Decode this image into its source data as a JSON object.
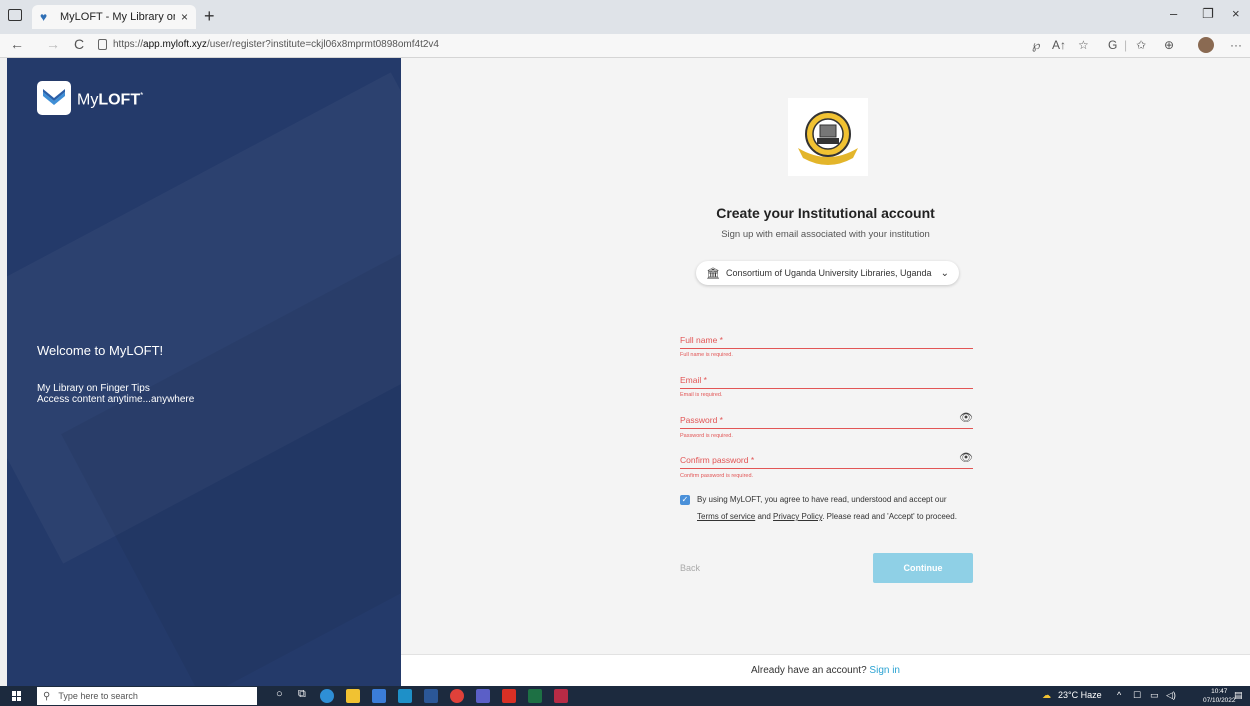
{
  "browser": {
    "tab_title": "MyLOFT - My Library on Finger T",
    "tab_close": "×",
    "new_tab": "+",
    "url_prefix": "https://",
    "url_host": "app.myloft.xyz",
    "url_path": "/user/register?institute=ckjl06x8mprmt0898omf4t2v4",
    "window_controls": [
      "–",
      "❐",
      "×"
    ],
    "nav_icons": [
      "←",
      "→",
      "C"
    ],
    "toolbar_icons": [
      "℘",
      "A↑",
      "☆",
      "G",
      "|",
      "✩",
      "⊕"
    ],
    "more": "···"
  },
  "sidebar": {
    "brand_prefix": "My",
    "brand_bold": "LOFT",
    "brand_mark": "*",
    "welcome": "Welcome to MyLOFT!",
    "tagline1": "My Library on Finger Tips",
    "tagline2": "Access content anytime...anywhere"
  },
  "form": {
    "title": "Create your Institutional account",
    "subtitle": "Sign up with email associated with your institution",
    "institution": "Consortium of Uganda University Libraries, Uganda",
    "fields": [
      {
        "label": "Full name *",
        "error": "Full name is required."
      },
      {
        "label": "Email *",
        "error": "Email is required."
      },
      {
        "label": "Password *",
        "error": "Password is required."
      },
      {
        "label": "Confirm password *",
        "error": "Confirm password is required."
      }
    ],
    "consent_line1": "By using MyLOFT, you agree to have read, understood and accept our",
    "terms": "Terms of service",
    "and": " and ",
    "privacy": "Privacy Policy",
    "consent_rest": ". Please read and 'Accept' to proceed.",
    "back": "Back",
    "continue": "Continue",
    "footer_text": "Already have an account? ",
    "footer_link": "Sign in"
  },
  "taskbar": {
    "search_placeholder": "Type here to search",
    "weather": "23°C  Haze",
    "time": "10:47",
    "date": "07/10/2022"
  },
  "colors": {
    "sidebar_bg": "#243a6a",
    "error": "#e25555",
    "continue_bg": "#8fd0e6",
    "link": "#2aa2d2"
  }
}
